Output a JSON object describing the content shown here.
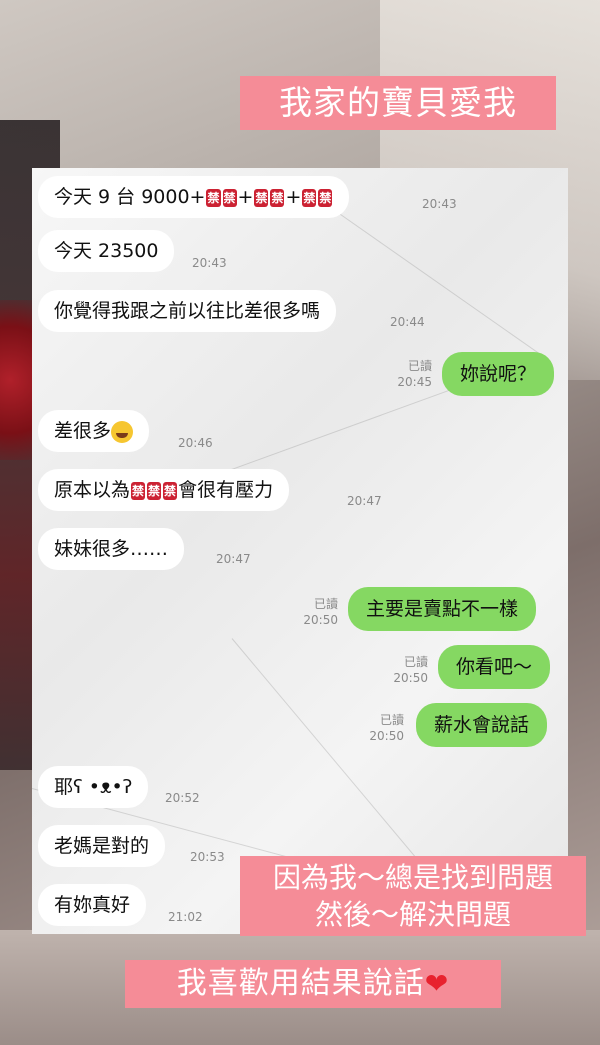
{
  "banners": {
    "top": "我家的寶貝愛我",
    "middle_line1": "因為我～總是找到問題",
    "middle_line2": "然後～解決問題",
    "bottom": "我喜歡用結果說話"
  },
  "badge_text": "禁",
  "messages": [
    {
      "side": "in",
      "text_before": "今天 9 台 9000+",
      "time": "20:43"
    },
    {
      "side": "in",
      "text": "今天 23500",
      "time": "20:43"
    },
    {
      "side": "in",
      "text": "你覺得我跟之前以往比差很多嗎",
      "time": "20:44"
    },
    {
      "side": "out",
      "text": "妳說呢？",
      "read": "已讀",
      "time": "20:45"
    },
    {
      "side": "in",
      "text": "差很多",
      "emoji": "rolling-laughing",
      "time": "20:46"
    },
    {
      "side": "in",
      "text_before": "原本以為",
      "text_after": "會很有壓力",
      "time": "20:47"
    },
    {
      "side": "in",
      "text": "妹妹很多……",
      "time": "20:47"
    },
    {
      "side": "out",
      "text": "主要是賣點不一樣",
      "read": "已讀",
      "time": "20:50"
    },
    {
      "side": "out",
      "text": "你看吧～",
      "read": "已讀",
      "time": "20:50"
    },
    {
      "side": "out",
      "text": "薪水會說話",
      "read": "已讀",
      "time": "20:50"
    },
    {
      "side": "in",
      "text": "耶ʕ •ᴥ•ʔ",
      "time": "20:52"
    },
    {
      "side": "in",
      "text": "老媽是對的",
      "time": "20:53"
    },
    {
      "side": "in",
      "text": "有妳真好",
      "time": "21:02"
    }
  ],
  "colors": {
    "banner_pink": "#f58c97",
    "outgoing_bubble": "#85d862",
    "incoming_bubble": "#ffffff",
    "badge_red": "#cc2233"
  }
}
